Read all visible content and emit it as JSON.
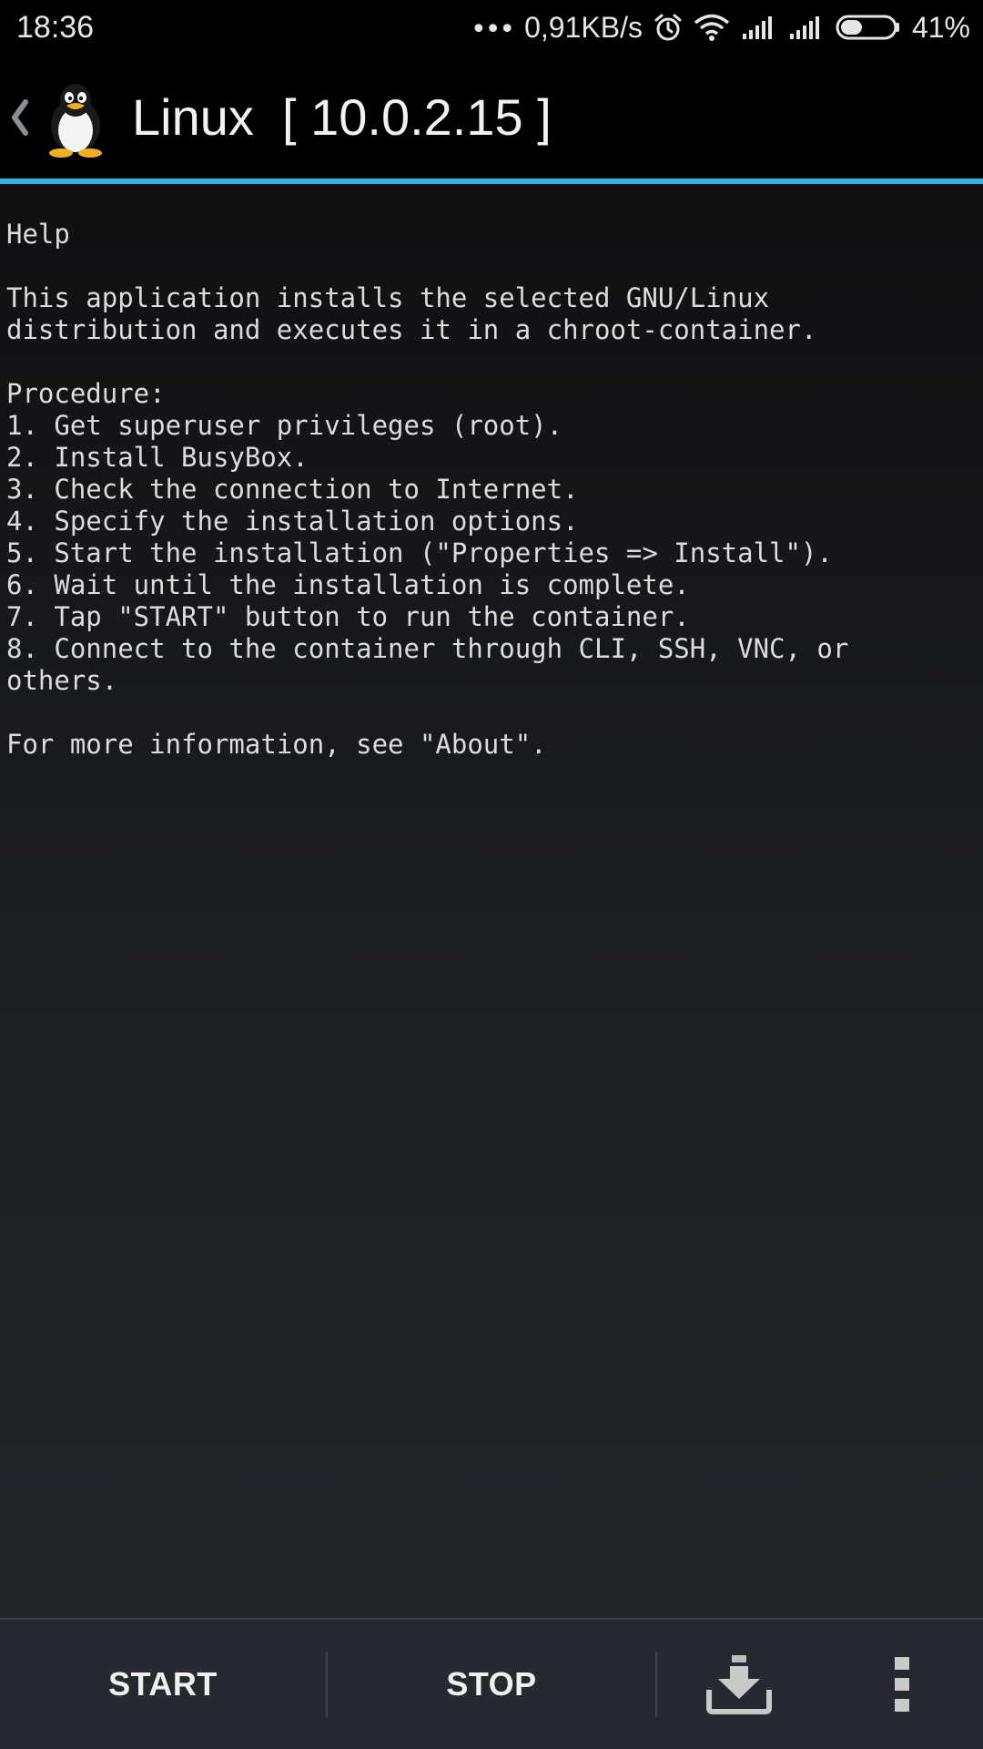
{
  "status_bar": {
    "time": "18:36",
    "dots": "•••",
    "net_speed": "0,91KB/s",
    "battery_percent": "41%",
    "battery_level": 0.41,
    "icons": [
      "more-dots-icon",
      "alarm-icon",
      "wifi-icon",
      "signal-icon",
      "signal-icon",
      "battery-icon"
    ]
  },
  "action_bar": {
    "title": "Linux  [ 10.0.2.15 ]",
    "back_icon": "chevron-left-icon",
    "logo_icon": "tux-penguin-icon"
  },
  "help": {
    "lines": [
      "Help",
      "",
      "This application installs the selected GNU/Linux",
      "distribution and executes it in a chroot-container.",
      "",
      "Procedure:",
      "1. Get superuser privileges (root).",
      "2. Install BusyBox.",
      "3. Check the connection to Internet.",
      "4. Specify the installation options.",
      "5. Start the installation (\"Properties => Install\").",
      "6. Wait until the installation is complete.",
      "7. Tap \"START\" button to run the container.",
      "8. Connect to the container through CLI, SSH, VNC, or",
      "others.",
      "",
      "For more information, see \"About\"."
    ]
  },
  "toolbar": {
    "start_label": "START",
    "stop_label": "STOP",
    "install_icon": "download-icon",
    "overflow_icon": "overflow-menu-icon"
  },
  "colors": {
    "accent": "#33b5e5",
    "action_bar_bg": "#000000",
    "content_bg": "#1d2024",
    "toolbar_bg": "#262a30",
    "text": "#dcdcdc"
  }
}
